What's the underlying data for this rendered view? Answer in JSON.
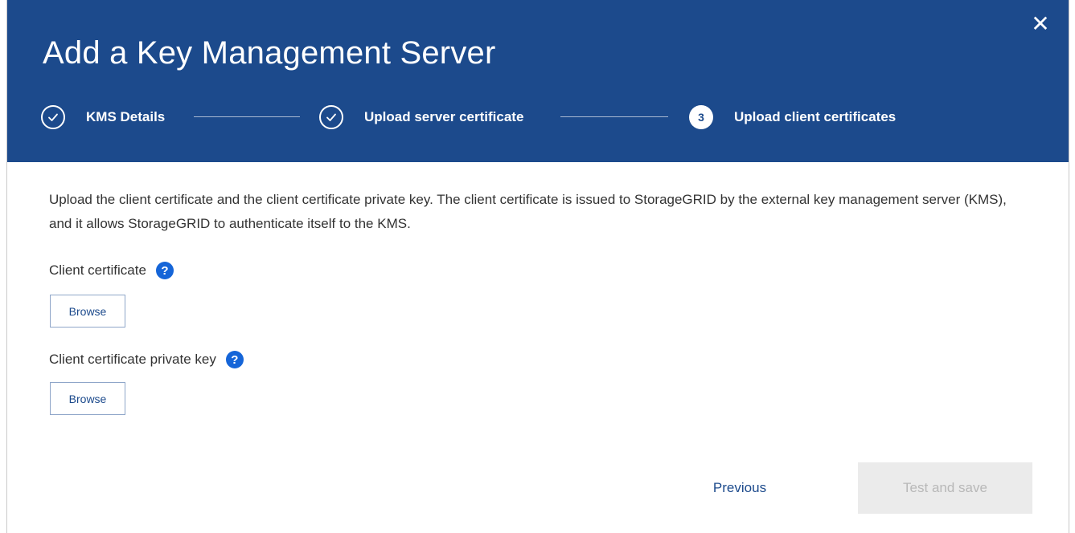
{
  "dialog": {
    "title": "Add a Key Management Server",
    "close_icon": "close-icon"
  },
  "steps": [
    {
      "label": "KMS Details",
      "state": "complete",
      "icon": "check-circle-icon"
    },
    {
      "label": "Upload server certificate",
      "state": "complete",
      "icon": "check-circle-icon"
    },
    {
      "label": "Upload client certificates",
      "state": "active",
      "number": "3"
    }
  ],
  "content": {
    "description": "Upload the client certificate and the client certificate private key. The client certificate is issued to StorageGRID by the external key management server (KMS), and it allows StorageGRID to authenticate itself to the KMS.",
    "client_certificate": {
      "label": "Client certificate",
      "help_icon": "help-icon",
      "button": "Browse"
    },
    "private_key": {
      "label": "Client certificate private key",
      "help_icon": "help-icon",
      "button": "Browse"
    }
  },
  "footer": {
    "previous_label": "Previous",
    "save_label": "Test and save",
    "save_enabled": false
  },
  "colors": {
    "header_bg": "#1c4a8c",
    "link": "#1c4a8c",
    "help_icon": "#1565d8",
    "disabled_bg": "#ebebeb",
    "disabled_text": "#b8b8b8"
  }
}
